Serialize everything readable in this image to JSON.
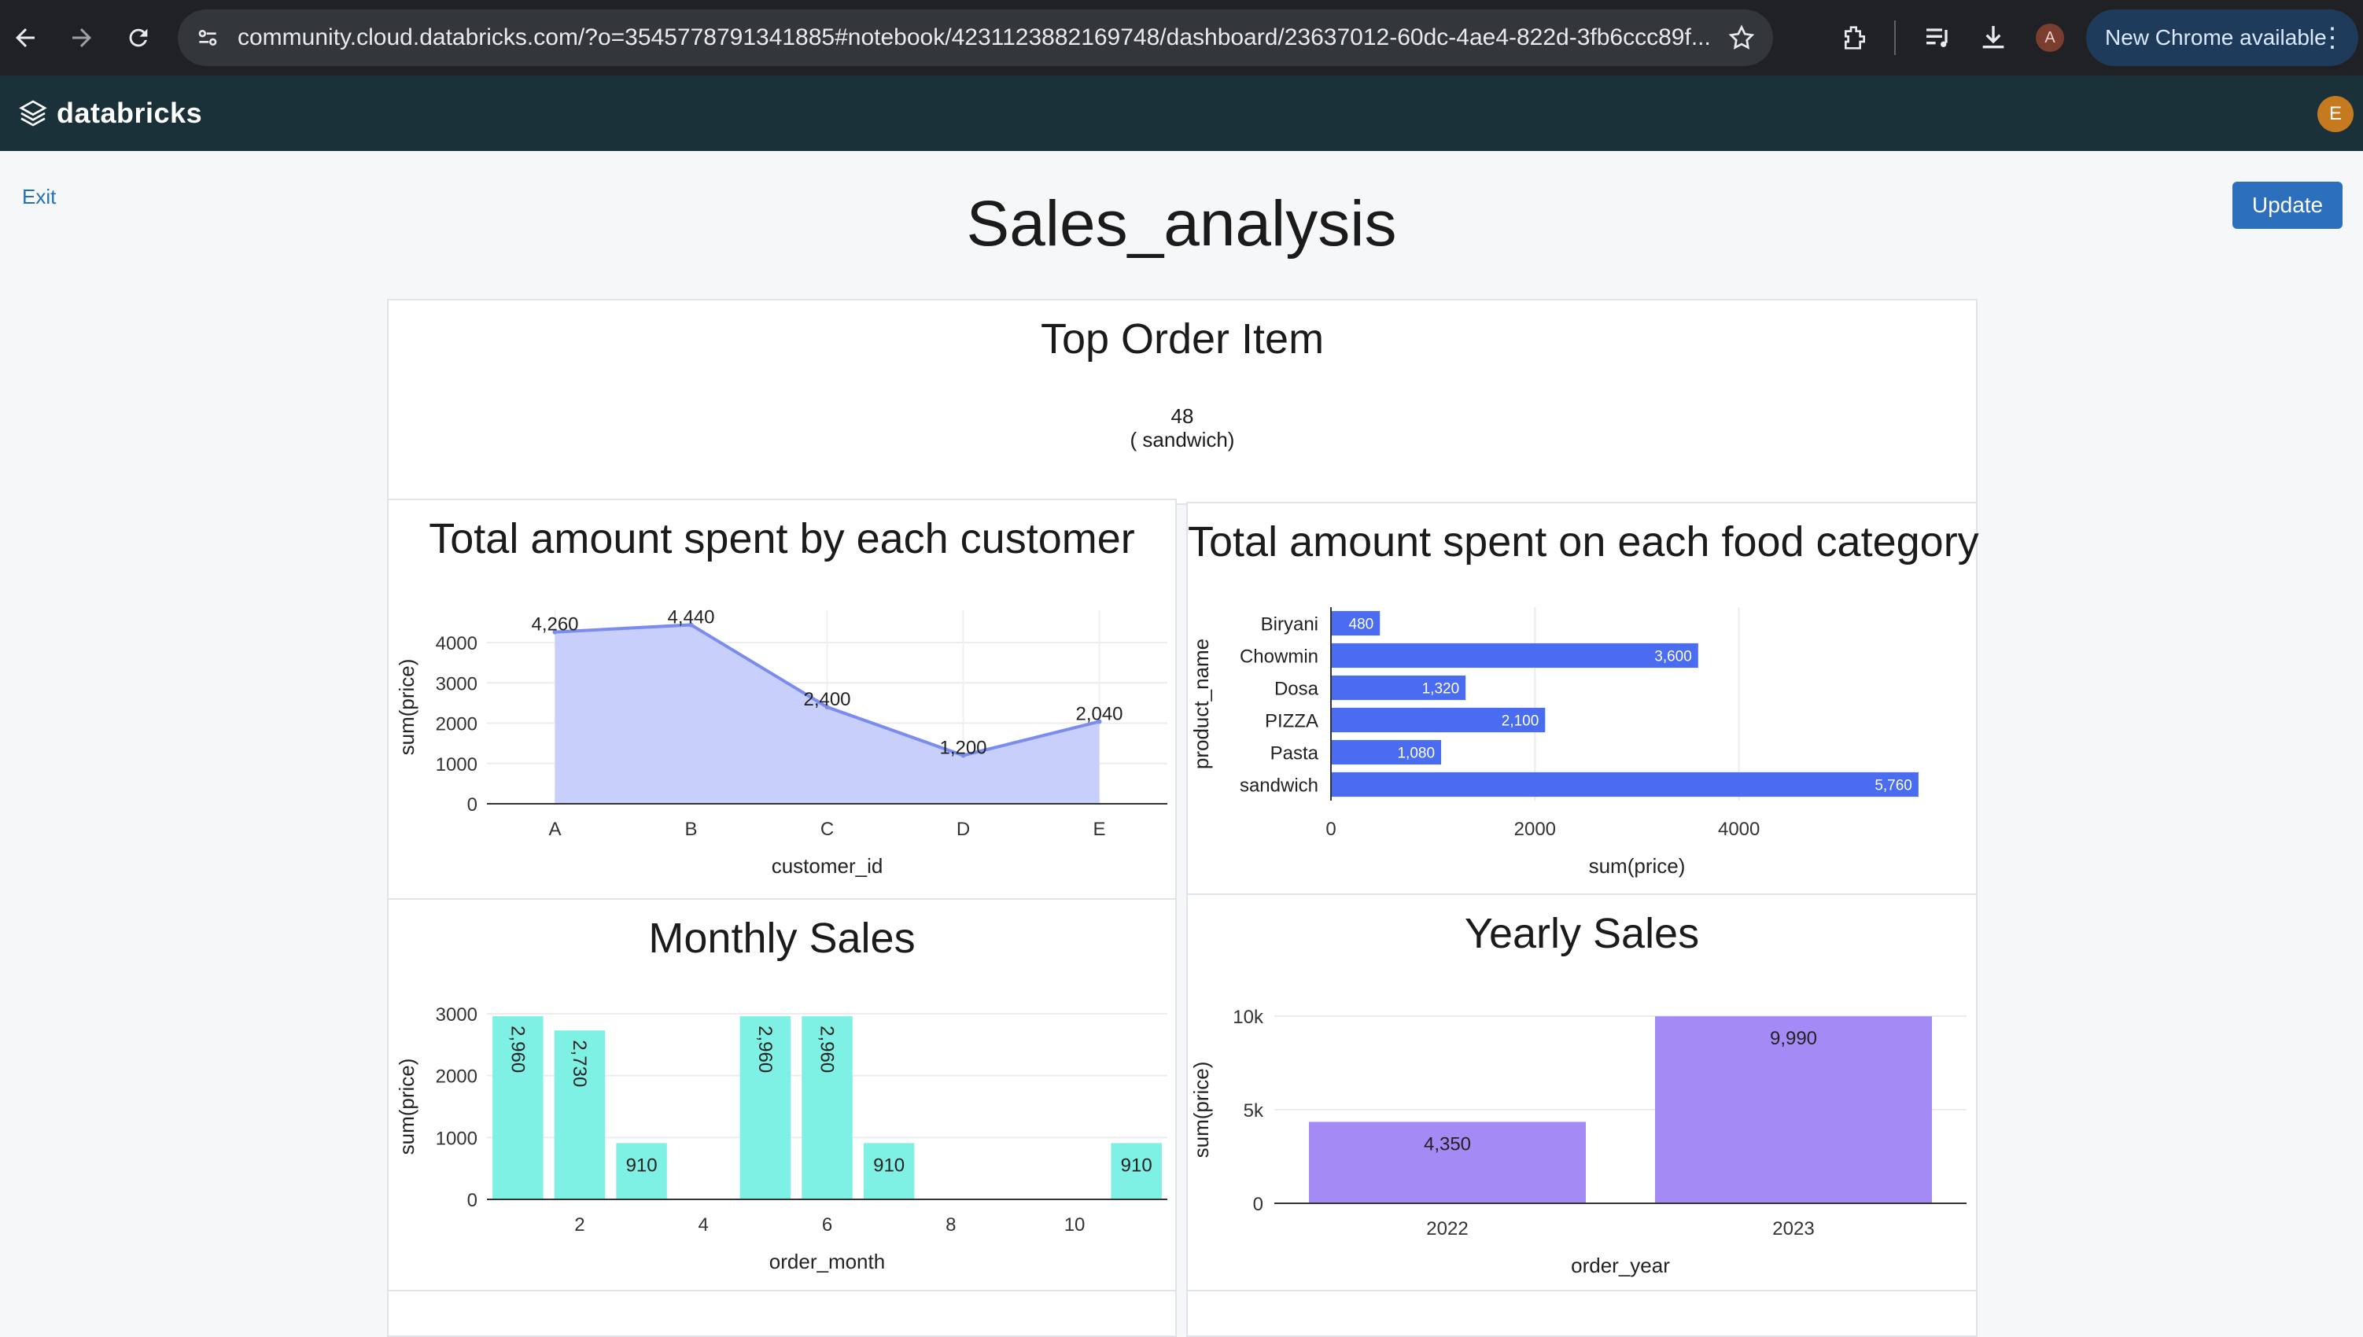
{
  "browser": {
    "url": "community.cloud.databricks.com/?o=3545778791341885#notebook/4231123882169748/dashboard/23637012-60dc-4ae4-822d-3fb6ccc89f...",
    "profile_initial": "A",
    "update_notice": "New Chrome available"
  },
  "app": {
    "logo_text": "databricks",
    "user_initial": "E"
  },
  "page": {
    "exit_label": "Exit",
    "update_label": "Update",
    "title": "Sales_analysis"
  },
  "counter": {
    "title": "Top Order Item",
    "value": "48",
    "label": "( sandwich)"
  },
  "chart_data": [
    {
      "type": "area",
      "title": "Total amount spent by each customer",
      "xlabel": "customer_id",
      "ylabel": "sum(price)",
      "categories": [
        "A",
        "B",
        "C",
        "D",
        "E"
      ],
      "values": [
        4260,
        4440,
        2400,
        1200,
        2040
      ],
      "data_labels": [
        "4,260",
        "4,440",
        "2,400",
        "1,200",
        "2,040"
      ],
      "yticks": [
        0,
        1000,
        2000,
        3000,
        4000
      ],
      "ylim": [
        0,
        4800
      ],
      "color": "#7b8cf0",
      "fill": "#c4ccfa",
      "grid": true
    },
    {
      "type": "bar",
      "orientation": "horizontal",
      "title": "Total amount spent on each food category",
      "xlabel": "sum(price)",
      "ylabel": "product_name",
      "categories": [
        "Biryani",
        "Chowmin",
        "Dosa",
        "PIZZA",
        "Pasta",
        "sandwich"
      ],
      "values": [
        480,
        3600,
        1320,
        2100,
        1080,
        5760
      ],
      "data_labels": [
        "480",
        "3,600",
        "1,320",
        "2,100",
        "1,080",
        "5,760"
      ],
      "xticks": [
        0,
        2000,
        4000
      ],
      "xlim": [
        0,
        6000
      ],
      "color": "#4a6cf0",
      "grid": true
    },
    {
      "type": "bar",
      "title": "Monthly Sales",
      "xlabel": "order_month",
      "ylabel": "sum(price)",
      "x": [
        1,
        2,
        3,
        5,
        6,
        7,
        11
      ],
      "values": [
        2960,
        2730,
        910,
        2960,
        2960,
        910,
        910
      ],
      "data_labels": [
        "2,960",
        "2,730",
        "910",
        "2,960",
        "2,960",
        "910",
        "910"
      ],
      "xticks": [
        2,
        4,
        6,
        8,
        10
      ],
      "yticks": [
        0,
        1000,
        2000,
        3000
      ],
      "xlim": [
        0.5,
        11.5
      ],
      "ylim": [
        0,
        3000
      ],
      "color": "#7ef0e4",
      "grid": true
    },
    {
      "type": "bar",
      "title": "Yearly Sales",
      "xlabel": "order_year",
      "ylabel": "sum(price)",
      "categories": [
        "2022",
        "2023"
      ],
      "values": [
        4350,
        9990
      ],
      "data_labels": [
        "4,350",
        "9,990"
      ],
      "yticks": [
        0,
        5000,
        10000
      ],
      "ytick_labels": [
        "0",
        "5k",
        "10k"
      ],
      "ylim": [
        0,
        10000
      ],
      "color": "#a48af5",
      "grid": true
    }
  ]
}
